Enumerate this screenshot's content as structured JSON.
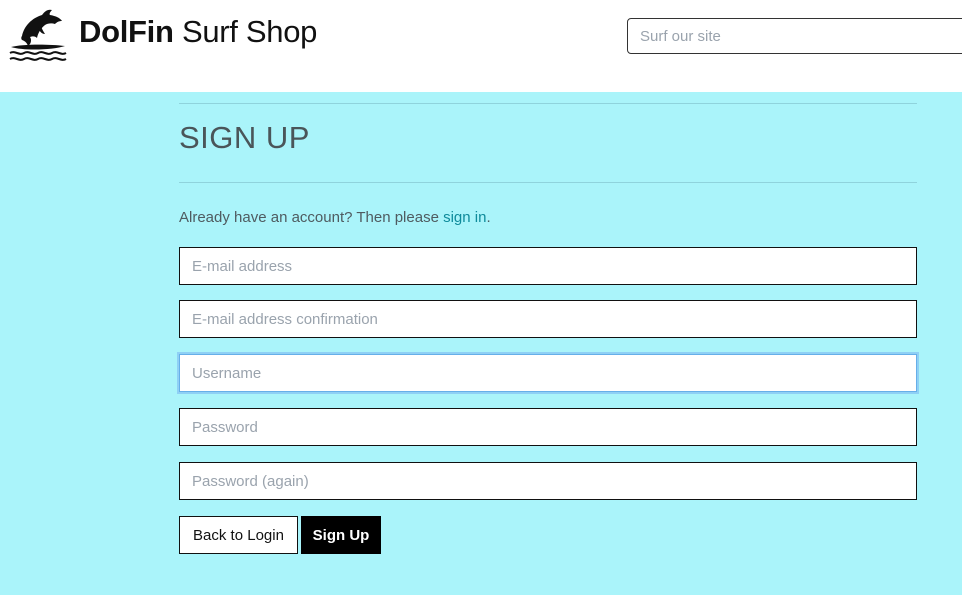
{
  "header": {
    "brand_bold": "DolFin",
    "brand_rest": "Surf Shop",
    "logo_icon": "dolphin-surfboard-logo-icon",
    "search_placeholder": "Surf our site"
  },
  "main": {
    "title": "SIGN UP",
    "intro_text": "Already have an account? Then please ",
    "intro_link": "sign in",
    "intro_suffix": ".",
    "fields": [
      {
        "placeholder": "E-mail address",
        "value": ""
      },
      {
        "placeholder": "E-mail address confirmation",
        "value": ""
      },
      {
        "placeholder": "Username",
        "value": "",
        "focused": true
      },
      {
        "placeholder": "Password",
        "value": ""
      },
      {
        "placeholder": "Password (again)",
        "value": ""
      }
    ],
    "back_button_label": "Back to Login",
    "signup_button_label": "Sign Up"
  },
  "colors": {
    "background": "#aaf4fa",
    "link": "#0f8b9b",
    "primary_button": "#000000"
  }
}
